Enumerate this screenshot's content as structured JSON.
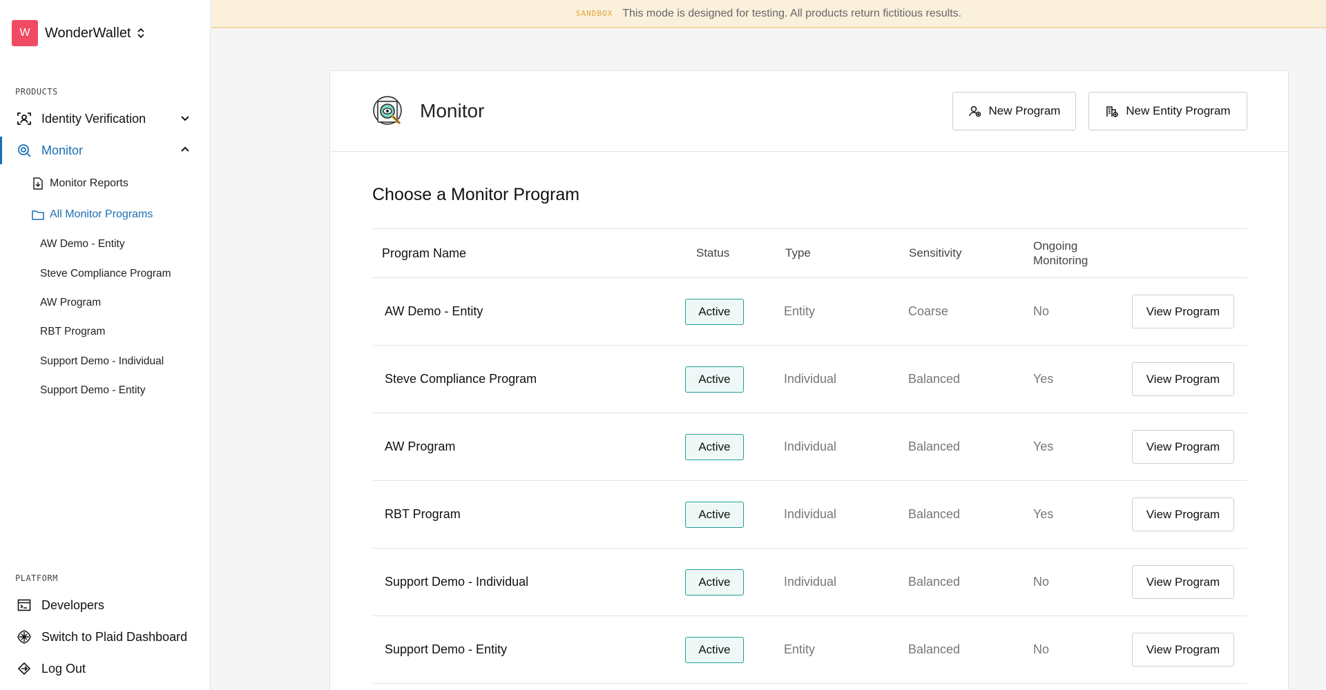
{
  "org": {
    "initial": "W",
    "name": "WonderWallet"
  },
  "sidebar": {
    "products_label": "PRODUCTS",
    "identity_verification": "Identity Verification",
    "monitor": "Monitor",
    "monitor_reports": "Monitor Reports",
    "all_monitor_programs": "All Monitor Programs",
    "programs": [
      "AW Demo - Entity",
      "Steve Compliance Program",
      "AW Program",
      "RBT Program",
      "Support Demo - Individual",
      "Support Demo - Entity"
    ],
    "platform_label": "PLATFORM",
    "developers": "Developers",
    "switch_dashboard": "Switch to Plaid Dashboard",
    "log_out": "Log Out"
  },
  "banner": {
    "tag": "SANDBOX",
    "text": "This mode is designed for testing. All products return fictitious results."
  },
  "main": {
    "title": "Monitor",
    "new_program": "New Program",
    "new_entity_program": "New Entity Program",
    "section_title": "Choose a Monitor Program",
    "columns": {
      "name": "Program Name",
      "status": "Status",
      "type": "Type",
      "sensitivity": "Sensitivity",
      "ongoing_1": "Ongoing",
      "ongoing_2": "Monitoring"
    },
    "view_label": "View Program",
    "rows": [
      {
        "name": "AW Demo - Entity",
        "status": "Active",
        "type": "Entity",
        "sensitivity": "Coarse",
        "ongoing": "No"
      },
      {
        "name": "Steve Compliance Program",
        "status": "Active",
        "type": "Individual",
        "sensitivity": "Balanced",
        "ongoing": "Yes"
      },
      {
        "name": "AW Program",
        "status": "Active",
        "type": "Individual",
        "sensitivity": "Balanced",
        "ongoing": "Yes"
      },
      {
        "name": "RBT Program",
        "status": "Active",
        "type": "Individual",
        "sensitivity": "Balanced",
        "ongoing": "Yes"
      },
      {
        "name": "Support Demo - Individual",
        "status": "Active",
        "type": "Individual",
        "sensitivity": "Balanced",
        "ongoing": "No"
      },
      {
        "name": "Support Demo - Entity",
        "status": "Active",
        "type": "Entity",
        "sensitivity": "Balanced",
        "ongoing": "No"
      }
    ]
  },
  "colors": {
    "accent": "#1a6fb5",
    "brand": "#ef4c63",
    "status_active": "#1f9e92",
    "banner_bg": "#fbf0dc"
  }
}
